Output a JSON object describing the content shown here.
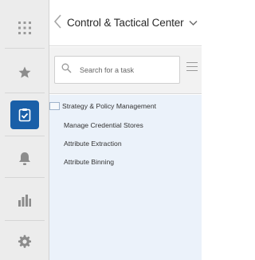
{
  "rail": {
    "items": [
      {
        "icon": "grid-icon"
      },
      {
        "icon": "star-icon"
      },
      {
        "icon": "clipboard-check-icon",
        "active": true
      },
      {
        "icon": "bell-icon"
      },
      {
        "icon": "bar-chart-icon"
      },
      {
        "icon": "gear-icon"
      }
    ],
    "accent": "#1a5fa8"
  },
  "header": {
    "title": "Control & Tactical Center"
  },
  "search": {
    "placeholder": "Search for a task"
  },
  "tree": {
    "items": [
      {
        "label": "Strategy & Policy Management"
      },
      {
        "label": "Manage Credential Stores"
      },
      {
        "label": "Attribute Extraction"
      },
      {
        "label": "Attribute Binning"
      }
    ]
  }
}
